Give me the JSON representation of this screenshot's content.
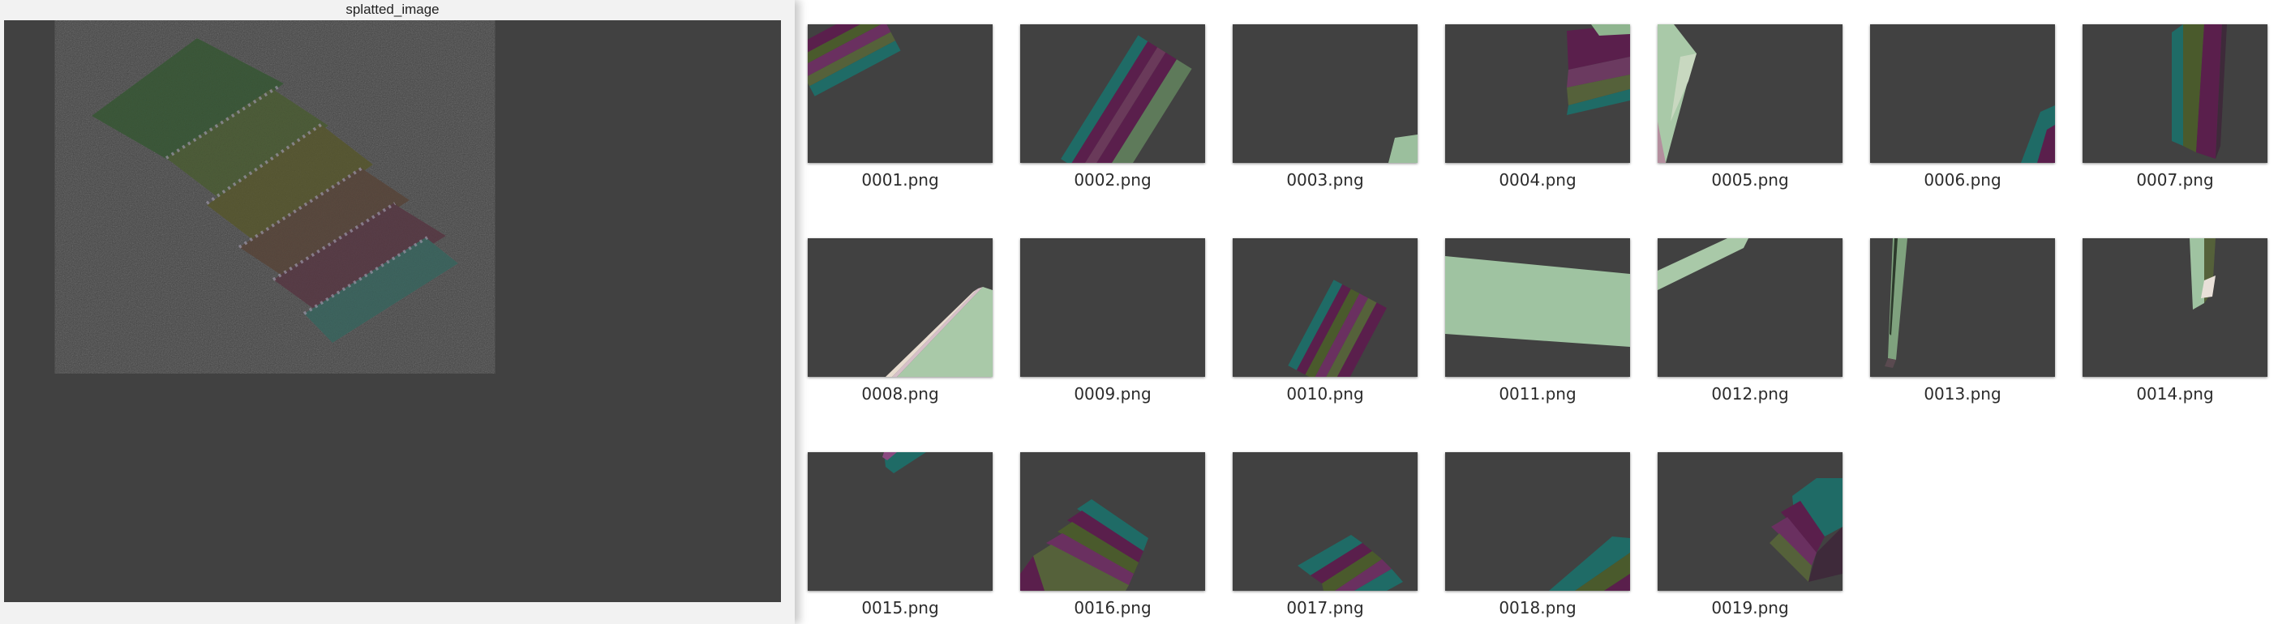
{
  "viewer": {
    "title": "splatted_image"
  },
  "files": [
    {
      "name": "0001.png"
    },
    {
      "name": "0002.png"
    },
    {
      "name": "0003.png"
    },
    {
      "name": "0004.png"
    },
    {
      "name": "0005.png"
    },
    {
      "name": "0006.png"
    },
    {
      "name": "0007.png"
    },
    {
      "name": "0008.png"
    },
    {
      "name": "0009.png"
    },
    {
      "name": "0010.png"
    },
    {
      "name": "0011.png"
    },
    {
      "name": "0012.png"
    },
    {
      "name": "0013.png"
    },
    {
      "name": "0014.png"
    },
    {
      "name": "0015.png"
    },
    {
      "name": "0016.png"
    },
    {
      "name": "0017.png"
    },
    {
      "name": "0018.png"
    },
    {
      "name": "0019.png"
    }
  ],
  "colors": {
    "canvas_bg": "#414141",
    "teal": "#1f6b66",
    "purple": "#5a1f4c",
    "olive": "#4a5a2c",
    "pale_green": "#a9c9a8"
  }
}
